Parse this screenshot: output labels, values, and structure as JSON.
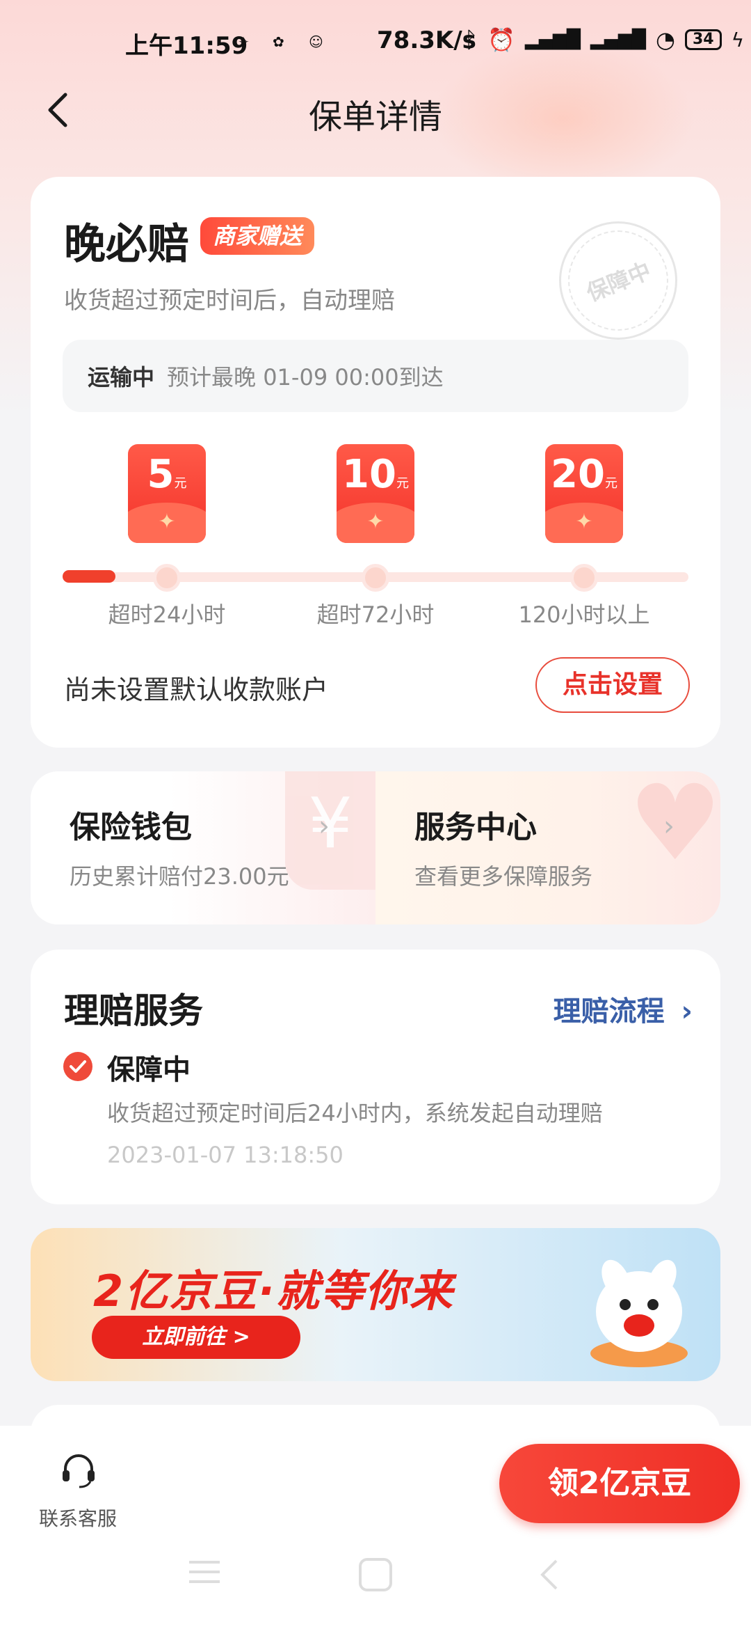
{
  "status_bar": {
    "time": "上午11:59",
    "net_speed": "78.3K/s",
    "battery": "34"
  },
  "header": {
    "title": "保单详情"
  },
  "policy": {
    "name": "晚必赔",
    "badge": "商家赠送",
    "description": "收货超过预定时间后，自动理赔",
    "stamp": "保障中",
    "transit_status": "运输中",
    "transit_eta": "预计最晚 01-09 00:00到达",
    "tiers": [
      {
        "amount": "5",
        "unit": "元",
        "label": "超时24小时"
      },
      {
        "amount": "10",
        "unit": "元",
        "label": "超时72小时"
      },
      {
        "amount": "20",
        "unit": "元",
        "label": "120小时以上"
      }
    ],
    "account_notice": "尚未设置默认收款账户",
    "set_button": "点击设置"
  },
  "shortcuts": {
    "wallet": {
      "title": "保险钱包",
      "subtitle": "历史累计赔付23.00元"
    },
    "service": {
      "title": "服务中心",
      "subtitle": "查看更多保障服务"
    }
  },
  "claims": {
    "title": "理赔服务",
    "process_link": "理赔流程",
    "status": "保障中",
    "status_desc": "收货超过预定时间后24小时内，系统发起自动理赔",
    "status_time": "2023-01-07 13:18:50"
  },
  "banner": {
    "headline": "2亿京豆·就等你来",
    "button": "立即前往 >"
  },
  "bottom_bar": {
    "customer_service": "联系客服",
    "cta": "领2亿京豆"
  },
  "colors": {
    "accent": "#ef2f26",
    "link": "#3a5fa8"
  }
}
